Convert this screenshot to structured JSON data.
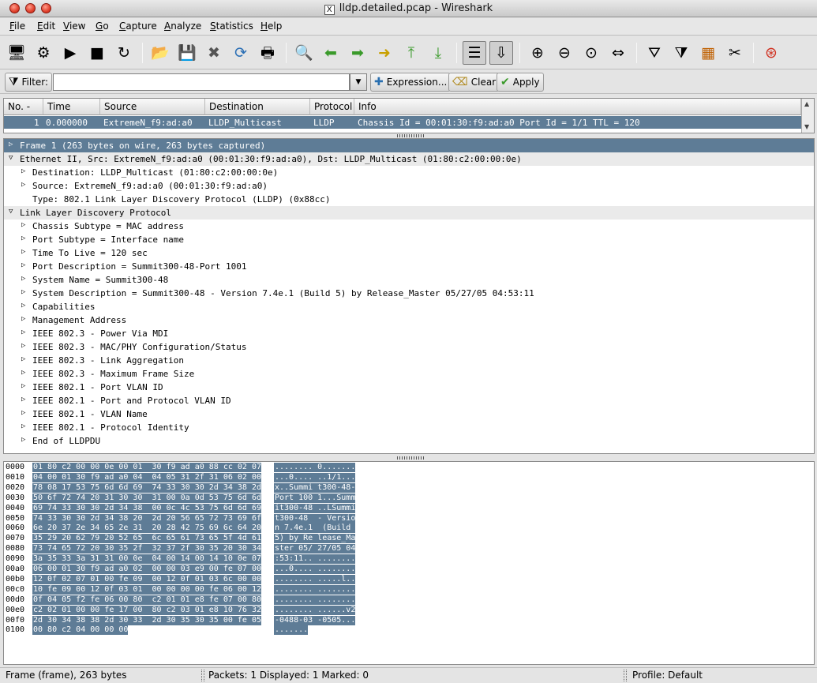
{
  "window": {
    "title": "lldp.detailed.pcap - Wireshark"
  },
  "menu": [
    "File",
    "Edit",
    "View",
    "Go",
    "Capture",
    "Analyze",
    "Statistics",
    "Help"
  ],
  "menu_underline": [
    "F",
    "E",
    "V",
    "G",
    "C",
    "A",
    "S",
    "H"
  ],
  "toolbar": {
    "icons": [
      "interfaces-icon",
      "capture-options-icon",
      "start-capture-icon",
      "stop-capture-icon",
      "restart-capture-icon",
      "open-file-icon",
      "save-file-icon",
      "close-file-icon",
      "reload-icon",
      "print-icon",
      "find-packet-icon",
      "go-back-icon",
      "go-forward-icon",
      "go-to-packet-icon",
      "first-packet-icon",
      "last-packet-icon",
      "colorize-icon",
      "auto-scroll-icon",
      "zoom-in-icon",
      "zoom-out-icon",
      "zoom-normal-icon",
      "resize-columns-icon",
      "capture-filters-icon",
      "display-filters-icon",
      "coloring-rules-icon",
      "preferences-icon",
      "help-icon"
    ]
  },
  "filter": {
    "label": "Filter:",
    "value": "",
    "expression_label": "Expression...",
    "clear_label": "Clear",
    "apply_label": "Apply"
  },
  "packet_list": {
    "columns": [
      "No. -",
      "Time",
      "Source",
      "Destination",
      "Protocol",
      "Info"
    ],
    "rows": [
      [
        "1",
        "0.000000",
        "ExtremeN_f9:ad:a0",
        "LLDP_Multicast",
        "LLDP",
        "Chassis Id = 00:01:30:f9:ad:a0 Port Id = 1/1 TTL = 120"
      ]
    ]
  },
  "details": [
    {
      "text": "Frame 1 (263 bytes on wire, 263 bytes captured)",
      "indent": 0,
      "state": "collapsed",
      "style": "selected"
    },
    {
      "text": "Ethernet II, Src: ExtremeN_f9:ad:a0 (00:01:30:f9:ad:a0), Dst: LLDP_Multicast (01:80:c2:00:00:0e)",
      "indent": 0,
      "state": "expanded",
      "style": "highlight"
    },
    {
      "text": "Destination: LLDP_Multicast (01:80:c2:00:00:0e)",
      "indent": 1,
      "state": "collapsed",
      "style": ""
    },
    {
      "text": "Source: ExtremeN_f9:ad:a0 (00:01:30:f9:ad:a0)",
      "indent": 1,
      "state": "collapsed",
      "style": ""
    },
    {
      "text": "Type: 802.1 Link Layer Discovery Protocol (LLDP) (0x88cc)",
      "indent": 1,
      "state": "leaf",
      "style": ""
    },
    {
      "text": "Link Layer Discovery Protocol",
      "indent": 0,
      "state": "expanded",
      "style": "highlight"
    },
    {
      "text": "Chassis Subtype = MAC address",
      "indent": 1,
      "state": "collapsed",
      "style": ""
    },
    {
      "text": "Port Subtype = Interface name",
      "indent": 1,
      "state": "collapsed",
      "style": ""
    },
    {
      "text": "Time To Live = 120 sec",
      "indent": 1,
      "state": "collapsed",
      "style": ""
    },
    {
      "text": "Port Description = Summit300-48-Port 1001",
      "indent": 1,
      "state": "collapsed",
      "style": ""
    },
    {
      "text": "System Name = Summit300-48",
      "indent": 1,
      "state": "collapsed",
      "style": ""
    },
    {
      "text": "System Description = Summit300-48 - Version 7.4e.1 (Build 5) by Release_Master 05/27/05 04:53:11",
      "indent": 1,
      "state": "collapsed",
      "style": ""
    },
    {
      "text": "Capabilities",
      "indent": 1,
      "state": "collapsed",
      "style": ""
    },
    {
      "text": "Management Address",
      "indent": 1,
      "state": "collapsed",
      "style": ""
    },
    {
      "text": "IEEE 802.3 - Power Via MDI",
      "indent": 1,
      "state": "collapsed",
      "style": ""
    },
    {
      "text": "IEEE 802.3 - MAC/PHY Configuration/Status",
      "indent": 1,
      "state": "collapsed",
      "style": ""
    },
    {
      "text": "IEEE 802.3 - Link Aggregation",
      "indent": 1,
      "state": "collapsed",
      "style": ""
    },
    {
      "text": "IEEE 802.3 - Maximum Frame Size",
      "indent": 1,
      "state": "collapsed",
      "style": ""
    },
    {
      "text": "IEEE 802.1 - Port VLAN ID",
      "indent": 1,
      "state": "collapsed",
      "style": ""
    },
    {
      "text": "IEEE 802.1 - Port and Protocol VLAN ID",
      "indent": 1,
      "state": "collapsed",
      "style": ""
    },
    {
      "text": "IEEE 802.1 - VLAN Name",
      "indent": 1,
      "state": "collapsed",
      "style": ""
    },
    {
      "text": "IEEE 802.1 - Protocol Identity",
      "indent": 1,
      "state": "collapsed",
      "style": ""
    },
    {
      "text": "End of LLDPDU",
      "indent": 1,
      "state": "collapsed",
      "style": ""
    }
  ],
  "hex": [
    {
      "offset": "0000",
      "bytes": "01 80 c2 00 00 0e 00 01  30 f9 ad a0 88 cc 02 07",
      "ascii": "........ 0......."
    },
    {
      "offset": "0010",
      "bytes": "04 00 01 30 f9 ad a0 04  04 05 31 2f 31 06 02 00",
      "ascii": "...0.... ..1/1..."
    },
    {
      "offset": "0020",
      "bytes": "78 08 17 53 75 6d 6d 69  74 33 30 30 2d 34 38 2d",
      "ascii": "x..Summi t300-48-"
    },
    {
      "offset": "0030",
      "bytes": "50 6f 72 74 20 31 30 30  31 00 0a 0d 53 75 6d 6d",
      "ascii": "Port 100 1...Summ"
    },
    {
      "offset": "0040",
      "bytes": "69 74 33 30 30 2d 34 38  00 0c 4c 53 75 6d 6d 69",
      "ascii": "it300-48 ..LSummi"
    },
    {
      "offset": "0050",
      "bytes": "74 33 30 30 2d 34 38 20  2d 20 56 65 72 73 69 6f",
      "ascii": "t300-48  - Versio"
    },
    {
      "offset": "0060",
      "bytes": "6e 20 37 2e 34 65 2e 31  20 28 42 75 69 6c 64 20",
      "ascii": "n 7.4e.1  (Build "
    },
    {
      "offset": "0070",
      "bytes": "35 29 20 62 79 20 52 65  6c 65 61 73 65 5f 4d 61",
      "ascii": "5) by Re lease_Ma"
    },
    {
      "offset": "0080",
      "bytes": "73 74 65 72 20 30 35 2f  32 37 2f 30 35 20 30 34",
      "ascii": "ster 05/ 27/05 04"
    },
    {
      "offset": "0090",
      "bytes": "3a 35 33 3a 31 31 00 0e  04 00 14 00 14 10 0e 07",
      "ascii": ":53:11.. ........"
    },
    {
      "offset": "00a0",
      "bytes": "06 00 01 30 f9 ad a0 02  00 00 03 e9 00 fe 07 00",
      "ascii": "...0.... ........"
    },
    {
      "offset": "00b0",
      "bytes": "12 0f 02 07 01 00 fe 09  00 12 0f 01 03 6c 00 00",
      "ascii": "........ .....l.."
    },
    {
      "offset": "00c0",
      "bytes": "10 fe 09 00 12 0f 03 01  00 00 00 00 fe 06 00 12",
      "ascii": "........ ........"
    },
    {
      "offset": "00d0",
      "bytes": "0f 04 05 f2 fe 06 00 80  c2 01 01 e8 fe 07 00 80",
      "ascii": "........ ........"
    },
    {
      "offset": "00e0",
      "bytes": "c2 02 01 00 00 fe 17 00  80 c2 03 01 e8 10 76 32",
      "ascii": "........ ......v2"
    },
    {
      "offset": "00f0",
      "bytes": "2d 30 34 38 38 2d 30 33  2d 30 35 30 35 00 fe 05",
      "ascii": "-0488-03 -0505..."
    },
    {
      "offset": "0100",
      "bytes": "00 80 c2 04 00 00 00",
      "ascii": "......."
    }
  ],
  "status": {
    "frame": "Frame (frame), 263 bytes",
    "packets": "Packets: 1 Displayed: 1 Marked: 0",
    "profile": "Profile: Default"
  },
  "colors": {
    "selection": "#5e7c96",
    "highlight": "#eaeaea"
  }
}
